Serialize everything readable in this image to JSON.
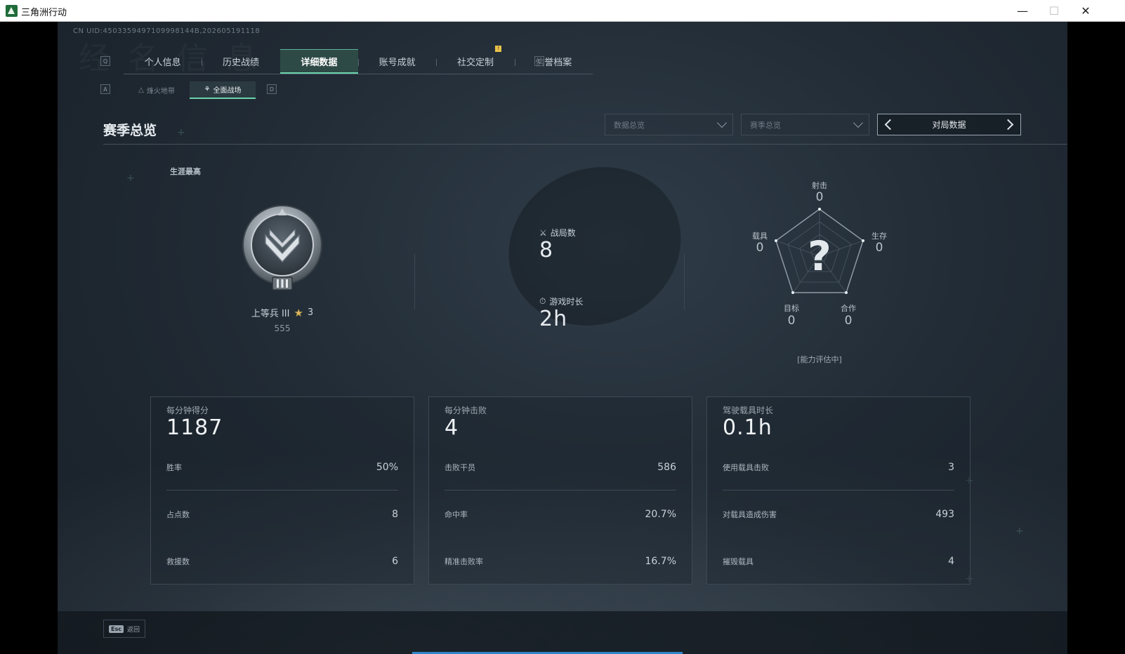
{
  "window": {
    "title": "三角洲行动"
  },
  "uid": "CN UID:4503359497109998144B,202605191118",
  "faint_heading": "经 名 信 息",
  "tabs": {
    "left_key": "Q",
    "right_key": "E",
    "items": [
      {
        "label": "个人信息"
      },
      {
        "label": "历史战绩"
      },
      {
        "label": "详细数据"
      },
      {
        "label": "账号成就"
      },
      {
        "label": "社交定制"
      },
      {
        "label": "信誉档案"
      }
    ],
    "notification_badge": "!"
  },
  "subtabs": {
    "left_key": "A",
    "right_key": "D",
    "items": [
      {
        "label": "烽火地带"
      },
      {
        "label": "全面战场"
      }
    ]
  },
  "section": {
    "title": "赛季总览"
  },
  "filters": {
    "data_overview": "数据总览",
    "season_overview": "赛季总览",
    "pager_label": "对局数据"
  },
  "career": {
    "label": "生涯最高",
    "rank_name": "上等兵 III",
    "stars": "3",
    "score": "555"
  },
  "summary": {
    "matches_label": "战局数",
    "matches_value": "8",
    "playtime_label": "游戏时长",
    "playtime_value": "2h"
  },
  "radar": {
    "center_mark": "?",
    "note": "[能力评估中]",
    "axes": {
      "shooting": {
        "label": "射击",
        "value": "0"
      },
      "survival": {
        "label": "生存",
        "value": "0"
      },
      "cooperation": {
        "label": "合作",
        "value": "0"
      },
      "objective": {
        "label": "目标",
        "value": "0"
      },
      "vehicle": {
        "label": "载具",
        "value": "0"
      }
    }
  },
  "cards": [
    {
      "title": "每分钟得分",
      "big": "1187",
      "rows": [
        {
          "k": "胜率",
          "v": "50%"
        },
        {
          "k": "占点数",
          "v": "8"
        },
        {
          "k": "救援数",
          "v": "6"
        }
      ]
    },
    {
      "title": "每分钟击败",
      "big": "4",
      "rows": [
        {
          "k": "击败干员",
          "v": "586"
        },
        {
          "k": "命中率",
          "v": "20.7%"
        },
        {
          "k": "精准击败率",
          "v": "16.7%"
        }
      ]
    },
    {
      "title": "驾驶载具时长",
      "big": "0.1h",
      "rows": [
        {
          "k": "使用载具击败",
          "v": "3"
        },
        {
          "k": "对载具造成伤害",
          "v": "493"
        },
        {
          "k": "摧毁载具",
          "v": "4"
        }
      ]
    }
  ],
  "footer": {
    "esc_key": "Esc",
    "back_label": "返回"
  },
  "colors": {
    "accent": "#6bd3ad",
    "active_tab_bg": "#2e4a46",
    "bottom_accent": "#2f86c9",
    "star": "#d9b55a"
  }
}
